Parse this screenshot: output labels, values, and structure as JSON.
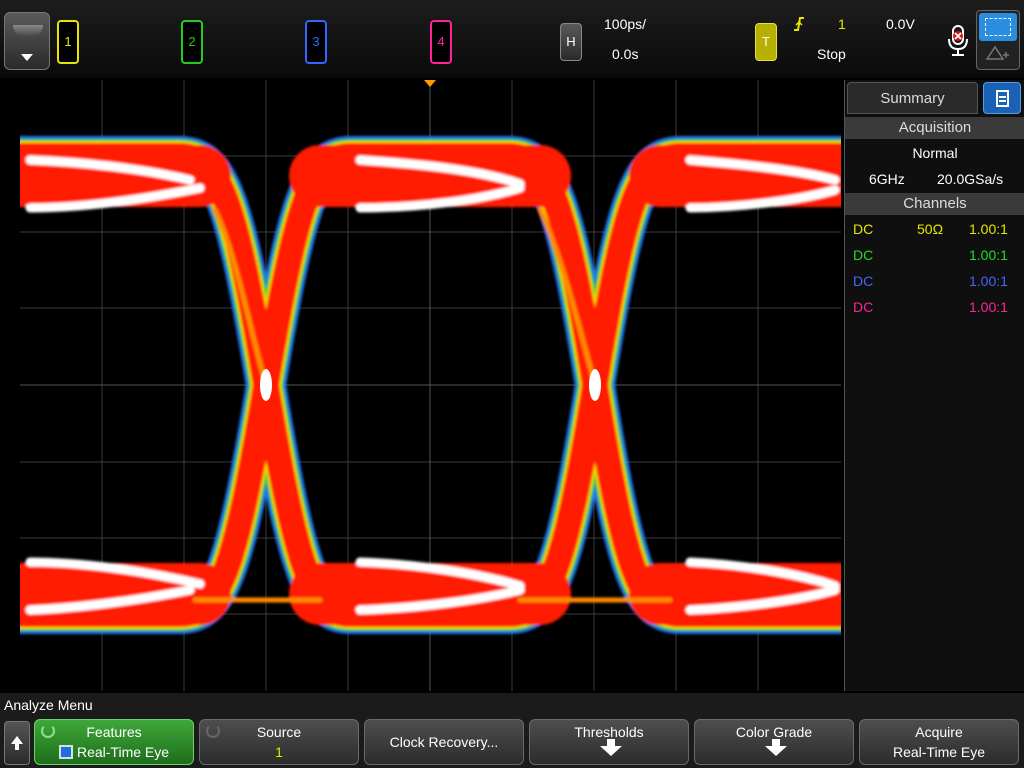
{
  "topbar": {
    "channels": [
      {
        "label": "1",
        "color": "#e6e600"
      },
      {
        "label": "2",
        "color": "#22cc22"
      },
      {
        "label": "3",
        "color": "#3366ff"
      },
      {
        "label": "4",
        "color": "#ff2299"
      }
    ],
    "horizontal": {
      "button": "H",
      "timebase": "100ps/",
      "position": "0.0s"
    },
    "trigger": {
      "button": "T",
      "source": "1",
      "level": "0.0V",
      "state": "Stop"
    }
  },
  "sidepanel": {
    "tab": "Summary",
    "acquisition_header": "Acquisition",
    "acq_mode": "Normal",
    "bandwidth": "6GHz",
    "sample_rate": "20.0GSa/s",
    "channels_header": "Channels",
    "channels": [
      {
        "coupling": "DC",
        "impedance": "50Ω",
        "probe": "1.00:1",
        "color": "#e6e600"
      },
      {
        "coupling": "DC",
        "impedance": "",
        "probe": "1.00:1",
        "color": "#22dd22"
      },
      {
        "coupling": "DC",
        "impedance": "",
        "probe": "1.00:1",
        "color": "#4466ff"
      },
      {
        "coupling": "DC",
        "impedance": "",
        "probe": "1.00:1",
        "color": "#ff2299"
      }
    ]
  },
  "menu": {
    "title": "Analyze Menu",
    "softkeys": {
      "features_label": "Features",
      "features_value": "Real-Time Eye",
      "source_label": "Source",
      "source_value": "1",
      "clock_recovery_label": "Clock Recovery...",
      "thresholds_label": "Thresholds",
      "color_grade_label": "Color Grade",
      "acquire_label": "Acquire",
      "acquire_value": "Real-Time Eye"
    }
  }
}
